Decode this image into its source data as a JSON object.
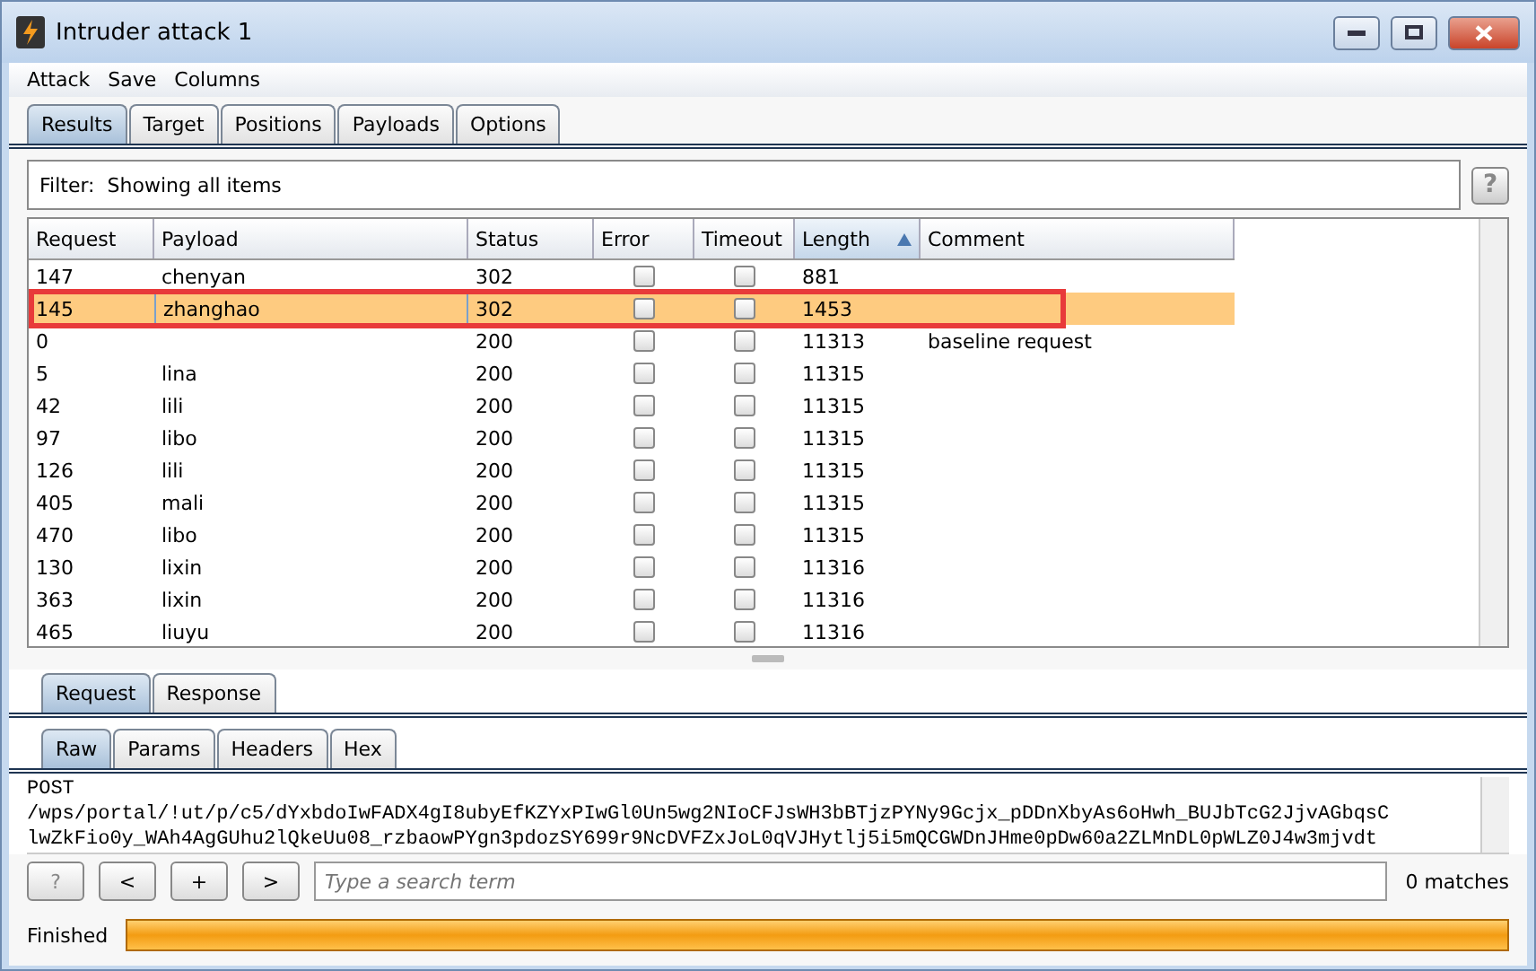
{
  "window": {
    "title": "Intruder attack 1"
  },
  "menu": [
    "Attack",
    "Save",
    "Columns"
  ],
  "tabs": [
    {
      "label": "Results",
      "selected": true
    },
    {
      "label": "Target",
      "selected": false
    },
    {
      "label": "Positions",
      "selected": false
    },
    {
      "label": "Payloads",
      "selected": false
    },
    {
      "label": "Options",
      "selected": false
    }
  ],
  "filter": {
    "label": "Filter:",
    "value": "Showing all items",
    "help": "?"
  },
  "table": {
    "columns": [
      {
        "label": "Request",
        "sorted": false
      },
      {
        "label": "Payload",
        "sorted": false
      },
      {
        "label": "Status",
        "sorted": false
      },
      {
        "label": "Error",
        "sorted": false
      },
      {
        "label": "Timeout",
        "sorted": false
      },
      {
        "label": "Length",
        "sorted": true
      },
      {
        "label": "Comment",
        "sorted": false
      }
    ],
    "rows": [
      {
        "request": "147",
        "payload": "chenyan",
        "status": "302",
        "error": false,
        "timeout": false,
        "length": "881",
        "comment": "",
        "selected": false,
        "highlighted": false
      },
      {
        "request": "145",
        "payload": "zhanghao",
        "status": "302",
        "error": false,
        "timeout": false,
        "length": "1453",
        "comment": "",
        "selected": true,
        "highlighted": true
      },
      {
        "request": "0",
        "payload": "",
        "status": "200",
        "error": false,
        "timeout": false,
        "length": "11313",
        "comment": "baseline request",
        "selected": false,
        "highlighted": false
      },
      {
        "request": "5",
        "payload": "lina",
        "status": "200",
        "error": false,
        "timeout": false,
        "length": "11315",
        "comment": "",
        "selected": false,
        "highlighted": false
      },
      {
        "request": "42",
        "payload": "lili",
        "status": "200",
        "error": false,
        "timeout": false,
        "length": "11315",
        "comment": "",
        "selected": false,
        "highlighted": false
      },
      {
        "request": "97",
        "payload": "libo",
        "status": "200",
        "error": false,
        "timeout": false,
        "length": "11315",
        "comment": "",
        "selected": false,
        "highlighted": false
      },
      {
        "request": "126",
        "payload": "lili",
        "status": "200",
        "error": false,
        "timeout": false,
        "length": "11315",
        "comment": "",
        "selected": false,
        "highlighted": false
      },
      {
        "request": "405",
        "payload": "mali",
        "status": "200",
        "error": false,
        "timeout": false,
        "length": "11315",
        "comment": "",
        "selected": false,
        "highlighted": false
      },
      {
        "request": "470",
        "payload": "libo",
        "status": "200",
        "error": false,
        "timeout": false,
        "length": "11315",
        "comment": "",
        "selected": false,
        "highlighted": false
      },
      {
        "request": "130",
        "payload": "lixin",
        "status": "200",
        "error": false,
        "timeout": false,
        "length": "11316",
        "comment": "",
        "selected": false,
        "highlighted": false
      },
      {
        "request": "363",
        "payload": "lixin",
        "status": "200",
        "error": false,
        "timeout": false,
        "length": "11316",
        "comment": "",
        "selected": false,
        "highlighted": false
      },
      {
        "request": "465",
        "payload": "liuyu",
        "status": "200",
        "error": false,
        "timeout": false,
        "length": "11316",
        "comment": "",
        "selected": false,
        "highlighted": false
      }
    ]
  },
  "message_tabs": [
    {
      "label": "Request",
      "selected": true
    },
    {
      "label": "Response",
      "selected": false
    }
  ],
  "view_tabs": [
    {
      "label": "Raw",
      "selected": true
    },
    {
      "label": "Params",
      "selected": false
    },
    {
      "label": "Headers",
      "selected": false
    },
    {
      "label": "Hex",
      "selected": false
    }
  ],
  "raw_lines": [
    "POST",
    "/wps/portal/!ut/p/c5/dYxbdoIwFADX4gI8ubyEfKZYxPIwGl0Un5wg2NIoCFJsWH3bBTjzPYNy9Gcjx_pDDnXbyAs6oHwh_BUJbTcG2JjvAGbqsC",
    "lwZkFio0y_WAh4AgGUhu2lQkeUu08_rzbaowPYgn3pdozSY699r9NcDVFZxJoL0qVJHytlj5i5mQCGWDnJHme0pDw60a2ZLMnDL0pWLZ0J4w3mjvdt"
  ],
  "search": {
    "buttons": [
      "?",
      "<",
      "+",
      ">"
    ],
    "placeholder": "Type a search term",
    "matches": "0 matches"
  },
  "status_bar": {
    "label": "Finished",
    "level": 1
  }
}
